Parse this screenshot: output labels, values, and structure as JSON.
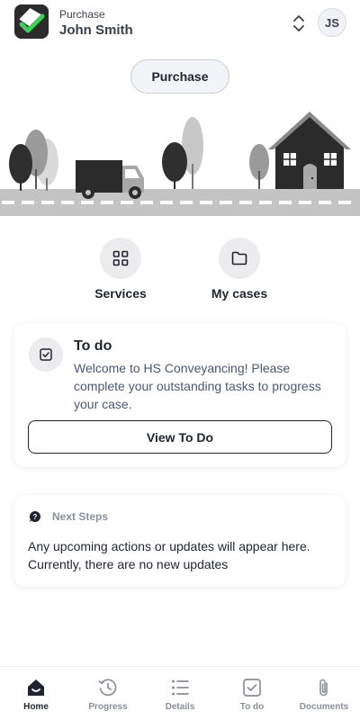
{
  "header": {
    "subtitle": "Purchase",
    "name": "John Smith",
    "avatar_initials": "JS",
    "logo_icon": "checkmark-logo-icon",
    "switch_icon": "chevron-up-down-icon"
  },
  "case_type_button": "Purchase",
  "illustration": {
    "description_icon": "road-van-house-illustration"
  },
  "actions": [
    {
      "label": "Services",
      "icon": "grid-icon"
    },
    {
      "label": "My cases",
      "icon": "folder-icon"
    }
  ],
  "todo_card": {
    "title": "To do",
    "text": "Welcome to HS Conveyancing! Please complete your outstanding tasks to progress your case.",
    "button_label": "View To Do",
    "icon": "checkbox-icon"
  },
  "next_steps": {
    "title": "Next Steps",
    "text": "Any upcoming actions or updates will appear here. Currently, there are no new updates",
    "icon": "chat-bubble-icon"
  },
  "bottom_nav": [
    {
      "label": "Home",
      "icon": "home-icon",
      "active": true
    },
    {
      "label": "Progress",
      "icon": "clock-icon",
      "active": false
    },
    {
      "label": "Details",
      "icon": "list-icon",
      "active": false
    },
    {
      "label": "To do",
      "icon": "checkbox-icon",
      "active": false
    },
    {
      "label": "Documents",
      "icon": "paperclip-icon",
      "active": false
    }
  ],
  "colors": {
    "text_primary": "#1f2430",
    "text_muted": "#8a8f9b",
    "text_secondary": "#4a5878",
    "logo_accent": "#3ecf5a",
    "circle_bg": "#ececef"
  }
}
